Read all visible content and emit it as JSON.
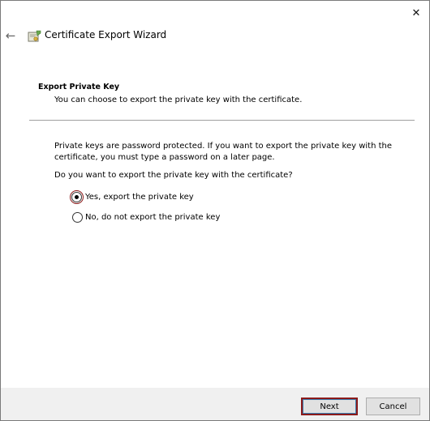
{
  "window": {
    "close_glyph": "✕",
    "back_glyph": "←"
  },
  "wizard": {
    "title": "Certificate Export Wizard",
    "icon": "certificate-wizard-icon"
  },
  "section": {
    "heading": "Export Private Key",
    "subtitle": "You can choose to export the private key with the certificate."
  },
  "body": {
    "paragraph": "Private keys are password protected. If you want to export the private key with the certificate, you must type a password on a later page.",
    "question": "Do you want to export the private key with the certificate?"
  },
  "options": [
    {
      "label": "Yes, export the private key",
      "selected": true
    },
    {
      "label": "No, do not export the private key",
      "selected": false
    }
  ],
  "buttons": {
    "next": "Next",
    "cancel": "Cancel"
  },
  "colors": {
    "focus_highlight": "#8b1a1a",
    "footer_bg": "#f0f0f0"
  }
}
